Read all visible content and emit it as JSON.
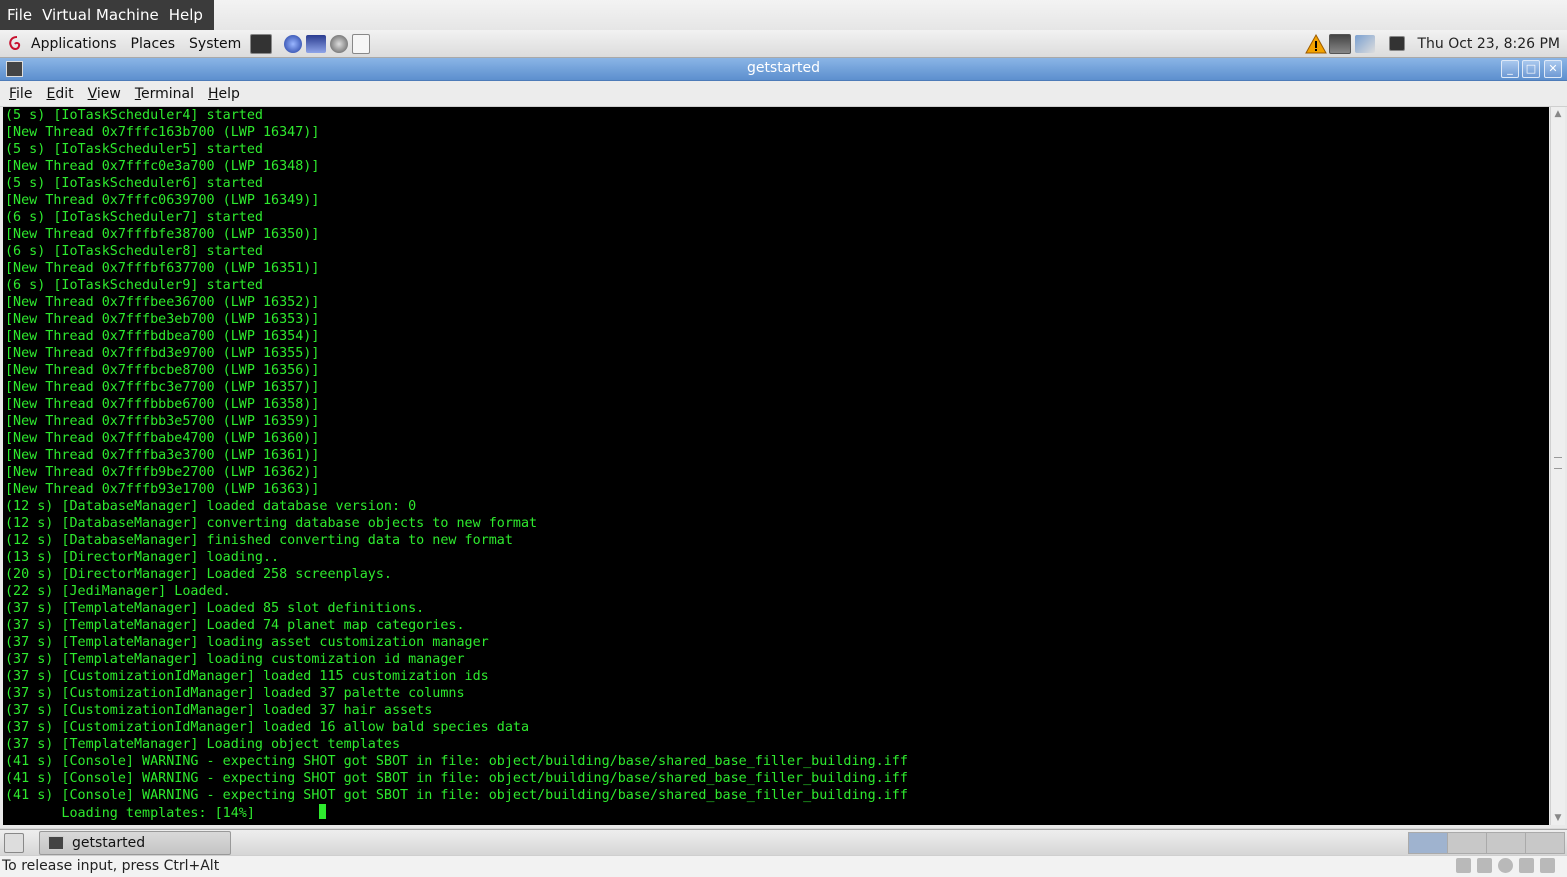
{
  "vm_menu": [
    "File",
    "Virtual Machine",
    "Help"
  ],
  "top_panel": {
    "menus": [
      "Applications",
      "Places",
      "System"
    ],
    "clock": "Thu Oct 23,  8:26 PM"
  },
  "window": {
    "title": "getstarted",
    "menu": [
      "File",
      "Edit",
      "View",
      "Terminal",
      "Help"
    ]
  },
  "terminal": {
    "lines": [
      "(5 s) [IoTaskScheduler4] started",
      "[New Thread 0x7fffc163b700 (LWP 16347)]",
      "(5 s) [IoTaskScheduler5] started",
      "[New Thread 0x7fffc0e3a700 (LWP 16348)]",
      "(5 s) [IoTaskScheduler6] started",
      "[New Thread 0x7fffc0639700 (LWP 16349)]",
      "(6 s) [IoTaskScheduler7] started",
      "[New Thread 0x7fffbfe38700 (LWP 16350)]",
      "(6 s) [IoTaskScheduler8] started",
      "[New Thread 0x7fffbf637700 (LWP 16351)]",
      "(6 s) [IoTaskScheduler9] started",
      "[New Thread 0x7fffbee36700 (LWP 16352)]",
      "[New Thread 0x7fffbe3eb700 (LWP 16353)]",
      "[New Thread 0x7fffbdbea700 (LWP 16354)]",
      "[New Thread 0x7fffbd3e9700 (LWP 16355)]",
      "[New Thread 0x7fffbcbe8700 (LWP 16356)]",
      "[New Thread 0x7fffbc3e7700 (LWP 16357)]",
      "[New Thread 0x7fffbbbe6700 (LWP 16358)]",
      "[New Thread 0x7fffbb3e5700 (LWP 16359)]",
      "[New Thread 0x7fffbabe4700 (LWP 16360)]",
      "[New Thread 0x7fffba3e3700 (LWP 16361)]",
      "[New Thread 0x7fffb9be2700 (LWP 16362)]",
      "[New Thread 0x7fffb93e1700 (LWP 16363)]",
      "(12 s) [DatabaseManager] loaded database version: 0",
      "(12 s) [DatabaseManager] converting database objects to new format",
      "(12 s) [DatabaseManager] finished converting data to new format",
      "(13 s) [DirectorManager] loading..",
      "(20 s) [DirectorManager] Loaded 258 screenplays.",
      "(22 s) [JediManager] Loaded.",
      "(37 s) [TemplateManager] Loaded 85 slot definitions.",
      "(37 s) [TemplateManager] Loaded 74 planet map categories.",
      "(37 s) [TemplateManager] loading asset customization manager",
      "(37 s) [TemplateManager] loading customization id manager",
      "(37 s) [CustomizationIdManager] loaded 115 customization ids",
      "(37 s) [CustomizationIdManager] loaded 37 palette columns",
      "(37 s) [CustomizationIdManager] loaded 37 hair assets",
      "(37 s) [CustomizationIdManager] loaded 16 allow bald species data",
      "(37 s) [TemplateManager] Loading object templates",
      "(41 s) [Console] WARNING - expecting SHOT got SBOT in file: object/building/base/shared_base_filler_building.iff",
      "(41 s) [Console] WARNING - expecting SHOT got SBOT in file: object/building/base/shared_base_filler_building.iff",
      "(41 s) [Console] WARNING - expecting SHOT got SBOT in file: object/building/base/shared_base_filler_building.iff"
    ],
    "progress_line": "       Loading templates: [14%]        "
  },
  "taskbar": {
    "task_label": "getstarted"
  },
  "status_bar": {
    "text": "To release input, press Ctrl+Alt"
  },
  "colors": {
    "terminal_fg": "#2eea2e",
    "terminal_bg": "#000000",
    "titlebar": "#6f9ad4"
  },
  "icons": [
    "debian-logo-icon",
    "terminal-launcher-icon",
    "web-browser-icon",
    "mail-icon",
    "help-icon",
    "warning-icon",
    "display-icon",
    "network-icon",
    "workspace-icon"
  ]
}
